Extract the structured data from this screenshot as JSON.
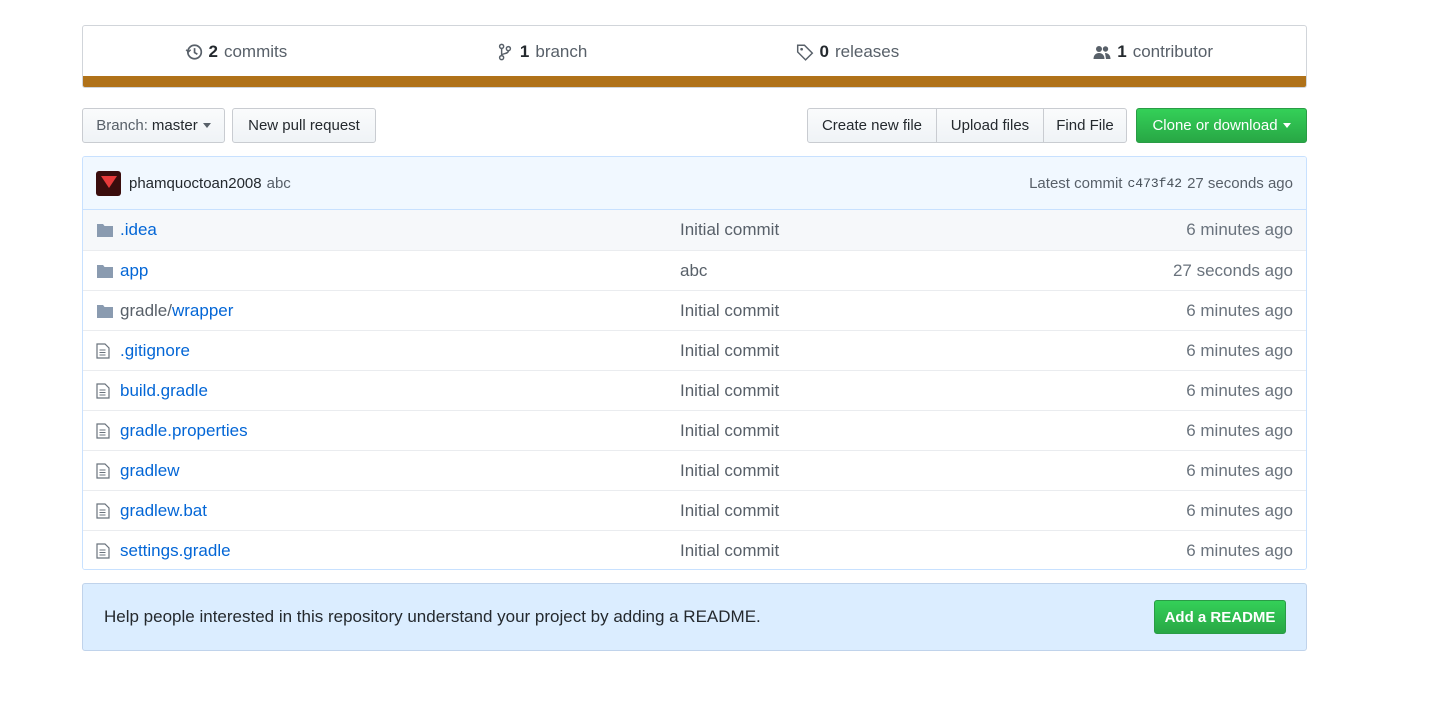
{
  "summary": {
    "commits": {
      "count": "2",
      "label": "commits"
    },
    "branches": {
      "count": "1",
      "label": "branch"
    },
    "releases": {
      "count": "0",
      "label": "releases"
    },
    "contributors": {
      "count": "1",
      "label": "contributor"
    },
    "language_color": "#b07219"
  },
  "toolbar": {
    "branch_prefix": "Branch:",
    "branch_name": "master",
    "new_pr": "New pull request",
    "create_file": "Create new file",
    "upload_files": "Upload files",
    "find_file": "Find File",
    "clone": "Clone or download"
  },
  "commit": {
    "author": "phamquoctoan2008",
    "message": "abc",
    "latest_label": "Latest commit",
    "sha": "c473f42",
    "age": "27 seconds ago"
  },
  "files": [
    {
      "type": "dir",
      "name": ".idea",
      "prefix": "",
      "message": "Initial commit",
      "age": "6 minutes ago"
    },
    {
      "type": "dir",
      "name": "app",
      "prefix": "",
      "message": "abc",
      "age": "27 seconds ago"
    },
    {
      "type": "dir",
      "name": "wrapper",
      "prefix": "gradle/",
      "message": "Initial commit",
      "age": "6 minutes ago"
    },
    {
      "type": "file",
      "name": ".gitignore",
      "prefix": "",
      "message": "Initial commit",
      "age": "6 minutes ago"
    },
    {
      "type": "file",
      "name": "build.gradle",
      "prefix": "",
      "message": "Initial commit",
      "age": "6 minutes ago"
    },
    {
      "type": "file",
      "name": "gradle.properties",
      "prefix": "",
      "message": "Initial commit",
      "age": "6 minutes ago"
    },
    {
      "type": "file",
      "name": "gradlew",
      "prefix": "",
      "message": "Initial commit",
      "age": "6 minutes ago"
    },
    {
      "type": "file",
      "name": "gradlew.bat",
      "prefix": "",
      "message": "Initial commit",
      "age": "6 minutes ago"
    },
    {
      "type": "file",
      "name": "settings.gradle",
      "prefix": "",
      "message": "Initial commit",
      "age": "6 minutes ago"
    }
  ],
  "readme": {
    "text": "Help people interested in this repository understand your project by adding a README.",
    "button": "Add a README"
  }
}
